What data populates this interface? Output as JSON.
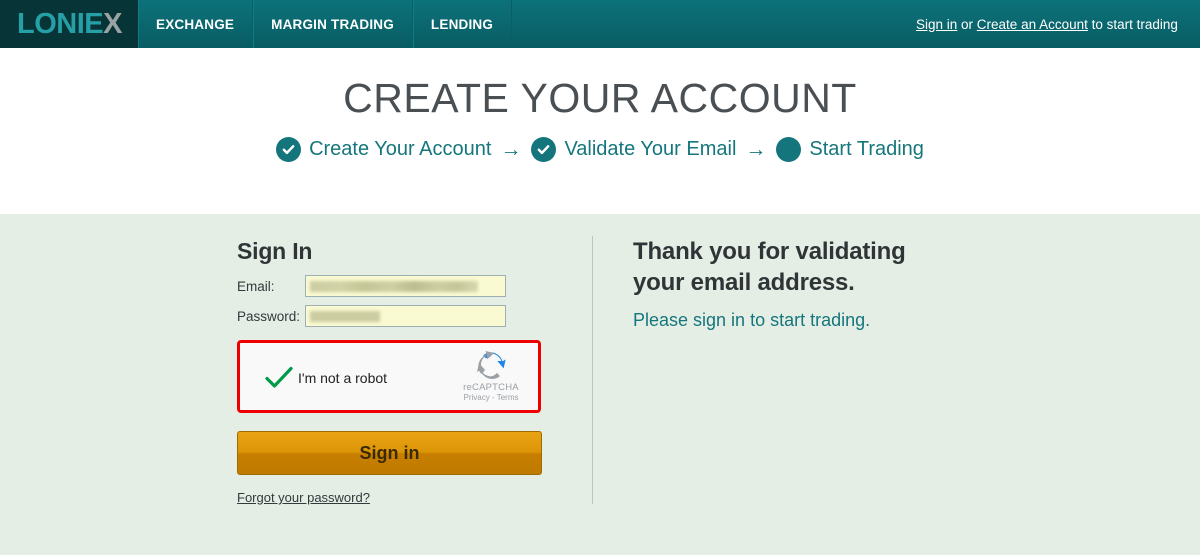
{
  "navbar": {
    "logo_main": "LONIEX",
    "logo_accent": "X",
    "tabs": [
      {
        "label": "EXCHANGE",
        "name": "exchange"
      },
      {
        "label": "MARGIN TRADING",
        "name": "margin-trading"
      },
      {
        "label": "LENDING",
        "name": "lending"
      }
    ],
    "right": {
      "sign_in_link": "Sign in",
      "separator": " or ",
      "create_account_link": "Create an Account",
      "trailing_text": " to start trading"
    },
    "colors": {
      "nav_background": "#0a6a70",
      "logo_background": "#073436",
      "logo_text": "#25a0a6",
      "logo_x_half": "#9aa3a3"
    }
  },
  "hero": {
    "title": "CREATE YOUR ACCOUNT",
    "steps": [
      {
        "label": "Create Your Account",
        "state": "complete",
        "icon": "check-circle-icon"
      },
      {
        "label": "Validate Your Email",
        "state": "complete",
        "icon": "check-circle-icon"
      },
      {
        "label": "Start Trading",
        "state": "current",
        "icon": "filled-circle-icon"
      }
    ],
    "arrow": "→",
    "colors": {
      "title": "#4a4f54",
      "step_teal": "#14757c",
      "background": "#ffffff"
    }
  },
  "main": {
    "background": "#e5eee5",
    "form": {
      "title": "Sign In",
      "email_label": "Email:",
      "email_value": "",
      "email_placeholder": "",
      "password_label": "Password:",
      "password_value": "",
      "password_placeholder": "",
      "submit_label": "Sign in",
      "forgot_label": "Forgot your password?",
      "input_background": "#fafad2"
    },
    "captcha": {
      "label": "I'm not a robot",
      "brand": "reCAPTCHA",
      "terms": "Privacy - Terms",
      "checked": true,
      "highlight_color": "#ef0000",
      "check_color": "#009a49"
    },
    "message": {
      "title_line1": "Thank you for validating",
      "title_line2": "your email address.",
      "subtitle": "Please sign in to start trading.",
      "title_color": "#2f3437",
      "subtitle_color": "#15767d"
    }
  }
}
